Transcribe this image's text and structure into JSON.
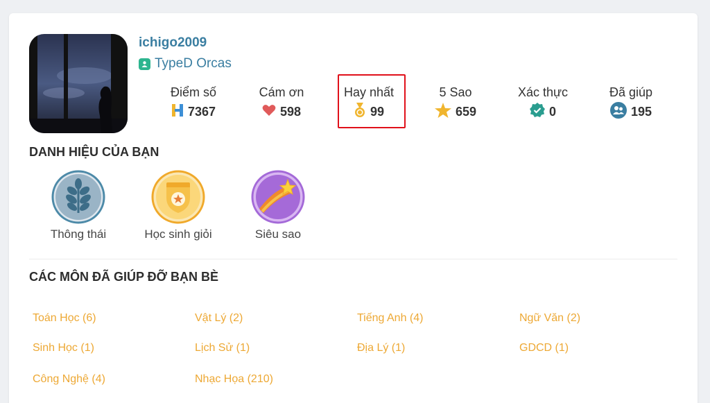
{
  "profile": {
    "username": "ichigo2009",
    "rank": "TypeD Orcas"
  },
  "stats": [
    {
      "label": "Điểm số",
      "value": "7367",
      "icon": "points-icon"
    },
    {
      "label": "Cám ơn",
      "value": "598",
      "icon": "heart-icon"
    },
    {
      "label": "Hay nhất",
      "value": "99",
      "icon": "medal-icon"
    },
    {
      "label": "5 Sao",
      "value": "659",
      "icon": "star-icon"
    },
    {
      "label": "Xác thực",
      "value": "0",
      "icon": "verified-icon"
    },
    {
      "label": "Đã giúp",
      "value": "195",
      "icon": "users-icon"
    }
  ],
  "badges_section": {
    "title": "DANH HIỆU CỦA BẠN",
    "items": [
      {
        "label": "Thông thái",
        "icon": "leaf-badge-icon"
      },
      {
        "label": "Học sinh giỏi",
        "icon": "shield-badge-icon"
      },
      {
        "label": "Siêu sao",
        "icon": "shooting-star-badge-icon"
      }
    ]
  },
  "subjects_section": {
    "title": "CÁC MÔN ĐÃ GIÚP ĐỠ BẠN BÈ",
    "items": [
      "Toán Học (6)",
      "Vật Lý (2)",
      "Tiếng Anh (4)",
      "Ngữ Văn (2)",
      "Sinh Học (1)",
      "Lịch Sử (1)",
      "Địa Lý (1)",
      "GDCD (1)",
      "Công Nghệ (4)",
      "Nhạc Họa (210)"
    ]
  },
  "colors": {
    "accent": "#3a7ea1",
    "subject_link": "#eda834",
    "highlight": "#e0101a"
  }
}
